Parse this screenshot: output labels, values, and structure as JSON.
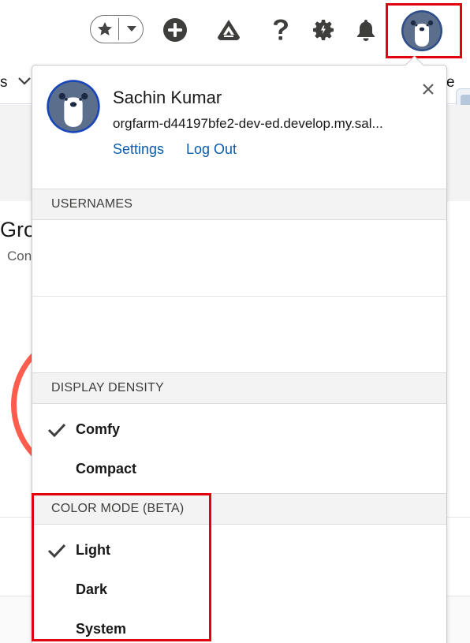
{
  "header": {
    "favorites_icon": "star-icon",
    "favorites_menu_icon": "caret-down-icon",
    "new_icon": "plus-icon",
    "trailhead_icon": "trailhead-icon",
    "help_icon": "question-icon",
    "setup_icon": "gear-icon",
    "notifications_icon": "bell-icon",
    "avatar_icon": "bear-avatar-icon"
  },
  "background": {
    "nav_left": "s",
    "nav_right": "e",
    "title": "Gro",
    "subtitle": "Con"
  },
  "profile": {
    "name": "Sachin Kumar",
    "org": "orgfarm-d44197bfe2-dev-ed.develop.my.sal...",
    "settings_link": "Settings",
    "logout_link": "Log Out"
  },
  "usernames": {
    "header": "USERNAMES"
  },
  "display_density": {
    "header": "DISPLAY DENSITY",
    "options": [
      {
        "label": "Comfy",
        "selected": true
      },
      {
        "label": "Compact",
        "selected": false
      }
    ]
  },
  "color_mode": {
    "header": "COLOR MODE (BETA)",
    "options": [
      {
        "label": "Light",
        "selected": true
      },
      {
        "label": "Dark",
        "selected": false
      },
      {
        "label": "System",
        "selected": false
      }
    ]
  },
  "colors": {
    "highlight": "#e3000f",
    "link": "#0b5cab",
    "avatar_blue": "#5b6e8c",
    "accent_ring": "#fe5c4c"
  }
}
